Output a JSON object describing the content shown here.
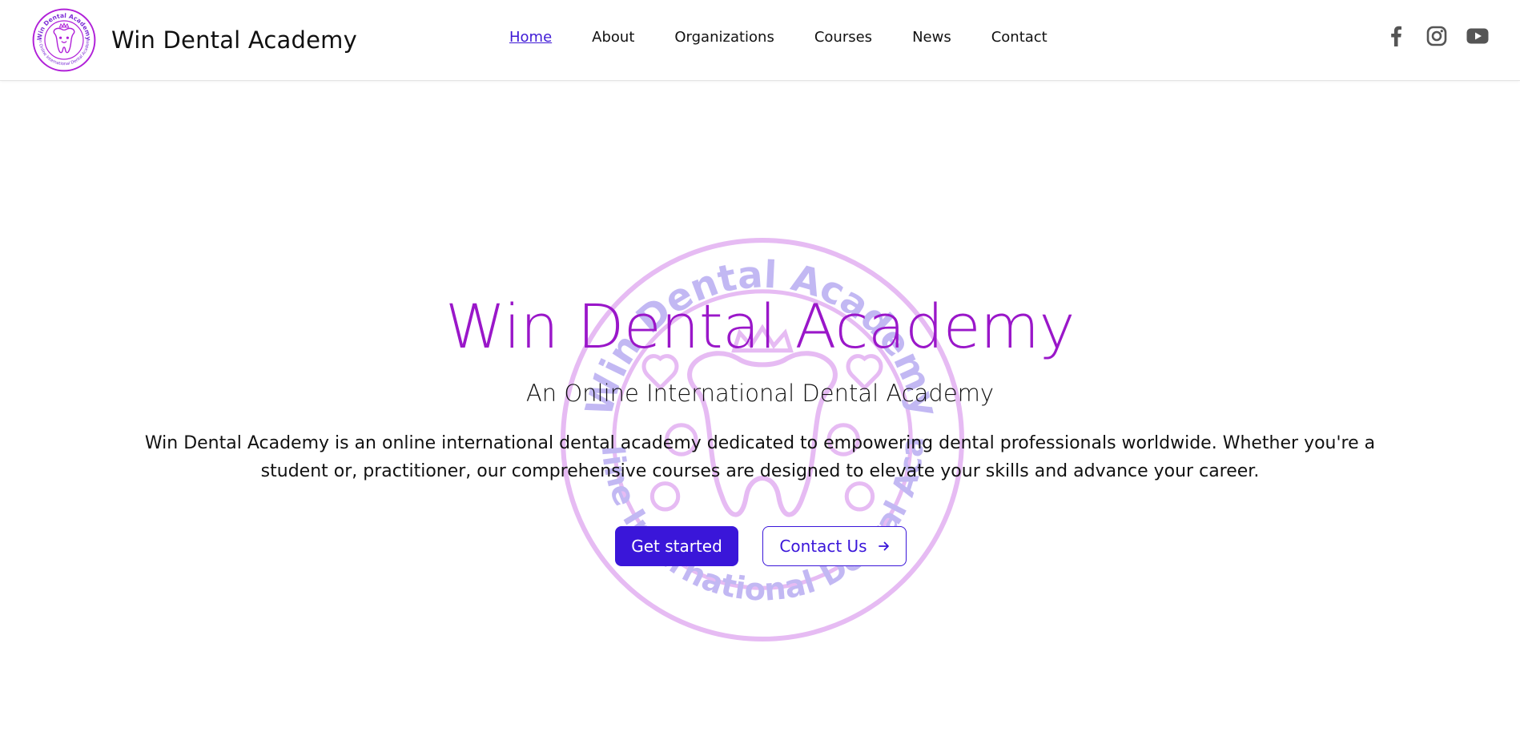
{
  "header": {
    "brand_name": "Win Dental Academy",
    "logo_text": {
      "top": "Win Dental Academy",
      "bottom": "An Online International Dental Academy"
    },
    "nav": [
      {
        "label": "Home",
        "active": true
      },
      {
        "label": "About",
        "active": false
      },
      {
        "label": "Organizations",
        "active": false
      },
      {
        "label": "Courses",
        "active": false
      },
      {
        "label": "News",
        "active": false
      },
      {
        "label": "Contact",
        "active": false
      }
    ],
    "social": [
      {
        "icon": "facebook-icon"
      },
      {
        "icon": "instagram-icon"
      },
      {
        "icon": "youtube-icon"
      }
    ]
  },
  "hero": {
    "title": "Win Dental Academy",
    "subtitle": "An Online International Dental Academy",
    "description": "Win Dental Academy is an online international dental academy dedicated to empowering dental professionals worldwide. Whether you're a student or, practitioner, our comprehensive courses are designed to elevate your skills and advance your career.",
    "primary_button": "Get started",
    "secondary_button": "Contact Us",
    "watermark_text": {
      "top": "Win Dental Academy",
      "bottom": "An Online International Dental Academy"
    }
  },
  "colors": {
    "accent": "#3a16d9",
    "brand_purple": "#9a17c9",
    "logo_purple": "#b020d8",
    "watermark_blue": "#3a16d9"
  }
}
